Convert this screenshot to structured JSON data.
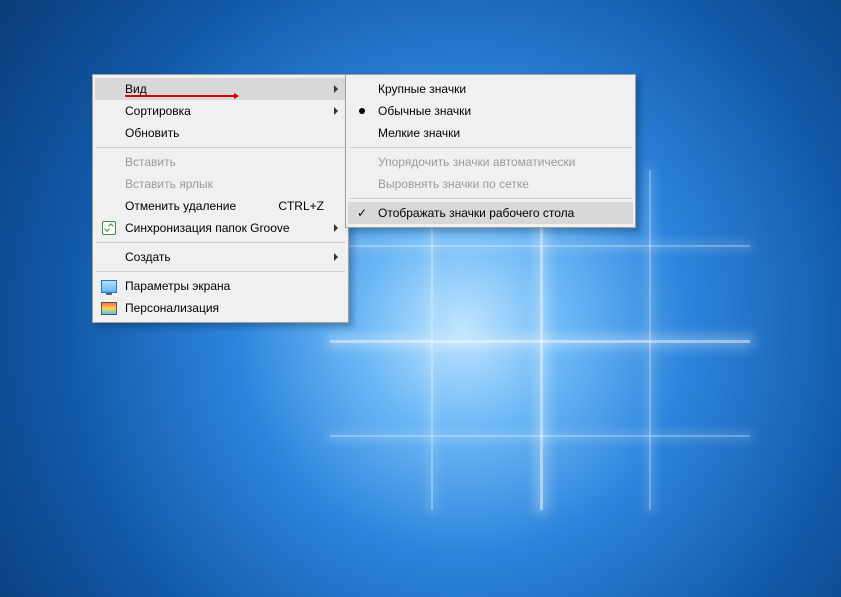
{
  "context_menu": {
    "items": [
      {
        "label": "Вид",
        "submenu": true,
        "highlighted": true,
        "annotated": true
      },
      {
        "label": "Сортировка",
        "submenu": true
      },
      {
        "label": "Обновить"
      },
      {
        "separator": true
      },
      {
        "label": "Вставить",
        "disabled": true
      },
      {
        "label": "Вставить ярлык",
        "disabled": true
      },
      {
        "label": "Отменить удаление",
        "shortcut": "CTRL+Z"
      },
      {
        "label": "Синхронизация папок Groove",
        "submenu": true,
        "icon": "groove-sync-icon"
      },
      {
        "separator": true
      },
      {
        "label": "Создать",
        "submenu": true
      },
      {
        "separator": true
      },
      {
        "label": "Параметры экрана",
        "icon": "display-settings-icon"
      },
      {
        "label": "Персонализация",
        "icon": "personalize-icon"
      }
    ]
  },
  "view_submenu": {
    "items": [
      {
        "label": "Крупные значки"
      },
      {
        "label": "Обычные значки",
        "radio_selected": true
      },
      {
        "label": "Мелкие значки"
      },
      {
        "separator": true
      },
      {
        "label": "Упорядочить значки автоматически",
        "disabled": true
      },
      {
        "label": "Выровнять значки по сетке",
        "disabled": true
      },
      {
        "separator": true
      },
      {
        "label": "Отображать значки рабочего стола",
        "checked": true,
        "highlighted": true
      }
    ]
  }
}
